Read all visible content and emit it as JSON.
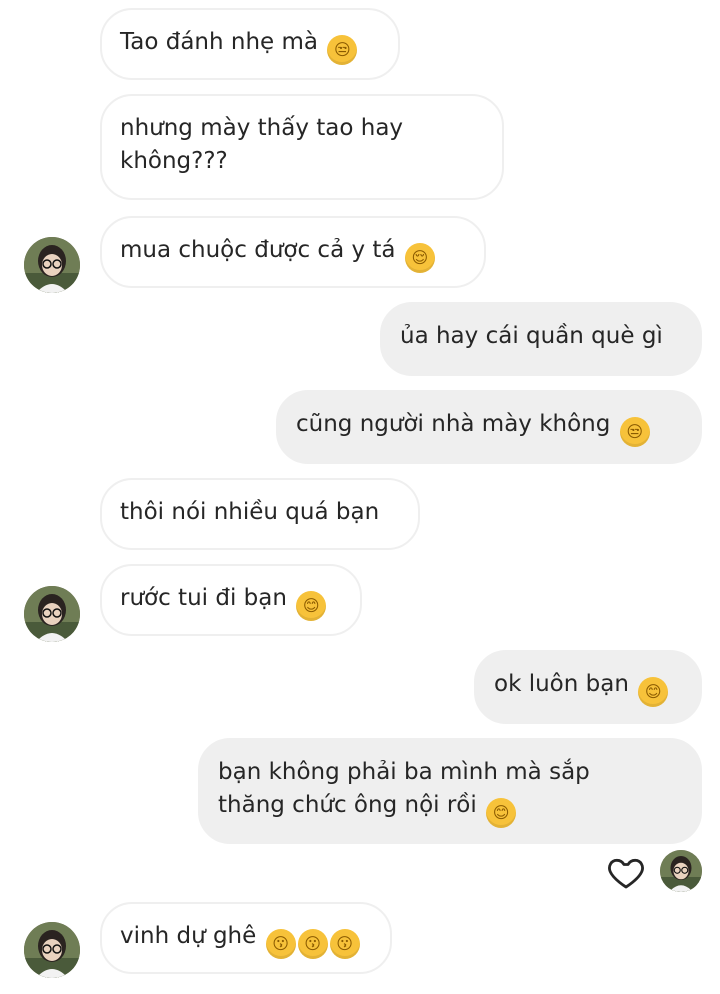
{
  "messages": [
    {
      "text": "Tao đánh nhẹ mà",
      "emoji": "😒"
    },
    {
      "line1": "nhưng mày thấy tao hay",
      "line2": "không???"
    },
    {
      "text": "mua chuộc được cả y tá",
      "emoji": "😌"
    },
    {
      "text": "ủa hay cái quần què gì"
    },
    {
      "text": "cũng người nhà mày không",
      "emoji": "😒"
    },
    {
      "text": "thôi nói nhiều quá bạn"
    },
    {
      "text": "rước tui đi bạn",
      "emoji": "😊"
    },
    {
      "text": "ok luôn bạn",
      "emoji": "😊"
    },
    {
      "line1": "bạn không phải ba mình mà sắp",
      "line2": "thăng chức ông nội rồi",
      "emoji": "😊"
    },
    {
      "text": "vinh dự ghê",
      "emoji1": "😗",
      "emoji2": "😗",
      "emoji3": "😗"
    }
  ],
  "icons": {
    "heart": "heart-icon",
    "avatar": "user-avatar"
  }
}
